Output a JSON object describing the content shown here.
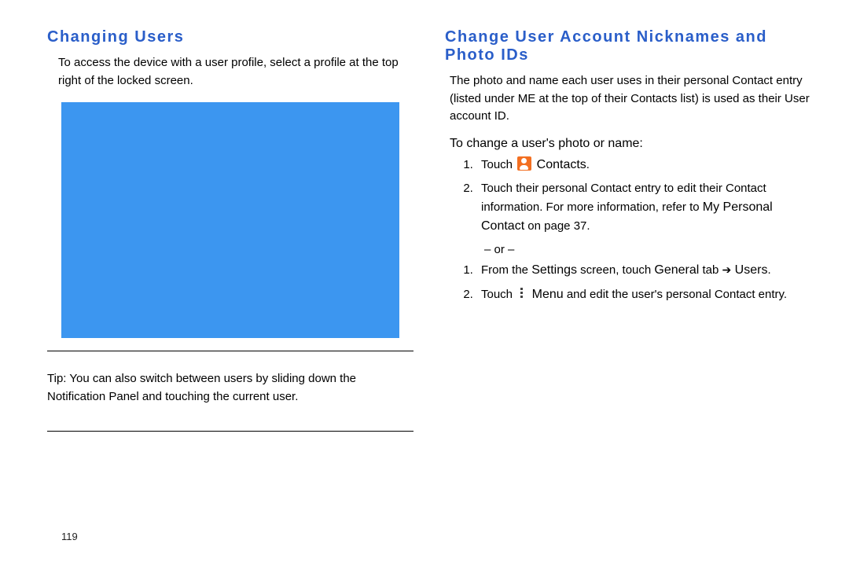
{
  "left": {
    "heading": "Changing Users",
    "intro": "To access the device with a user profile, select a profile at the top right of the locked screen.",
    "tip_label": "Tip:",
    "tip_body": " You can also switch between users by sliding down the Notification Panel and touching the current user."
  },
  "right": {
    "heading": "Change User Account Nicknames and Photo IDs",
    "intro": "The photo and name each user uses in their personal Contact entry (listed under ME at the top of their Contacts list) is used as their User account ID.",
    "subhead": "To change a user's photo or name:",
    "s1_a": "Touch ",
    "s1_b": " Contacts",
    "s1_c": ".",
    "s2_a": "Touch their personal Contact entry to edit their Contact information. For more information, refer to ",
    "s2_b": "My Personal Contact",
    "s2_c": " on page 37.",
    "or": "– or –",
    "s3_a": "From the ",
    "s3_b": "Settings",
    "s3_c": " screen, touch ",
    "s3_d": "General",
    "s3_e": " tab ",
    "s3_arrow": "➔",
    "s3_f": " Users",
    "s3_g": ".",
    "s4_a": "Touch ",
    "s4_b": " Menu",
    "s4_c": " and edit the user's personal Contact entry."
  },
  "page_number": "119"
}
